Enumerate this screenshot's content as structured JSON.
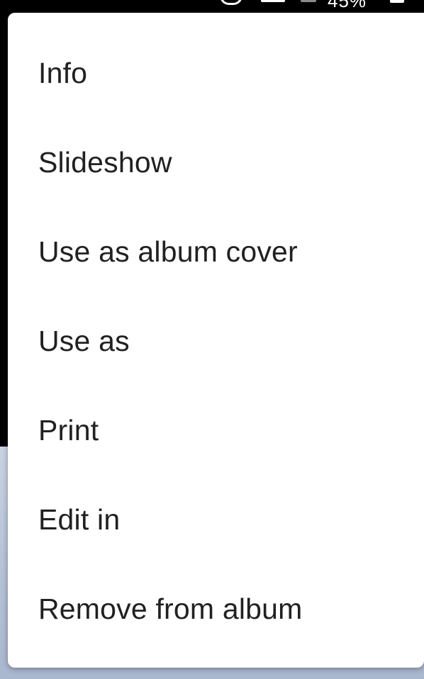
{
  "status_bar": {
    "battery_text": "45%"
  },
  "menu": {
    "items": [
      {
        "label": "Info"
      },
      {
        "label": "Slideshow"
      },
      {
        "label": "Use as album cover"
      },
      {
        "label": "Use as"
      },
      {
        "label": "Print"
      },
      {
        "label": "Edit in"
      },
      {
        "label": "Remove from album"
      }
    ]
  },
  "colors": {
    "menu_background": "#ffffff",
    "menu_text": "#212121",
    "scrim": "#000000"
  }
}
